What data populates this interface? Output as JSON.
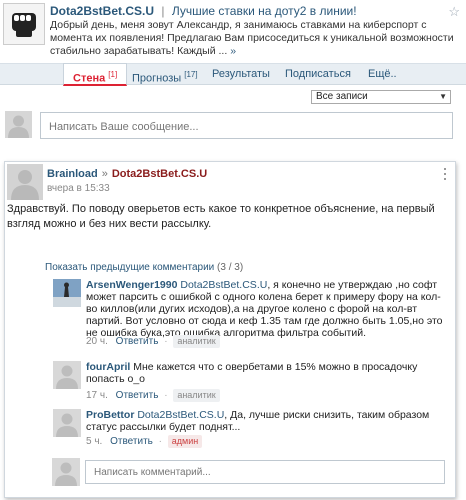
{
  "header": {
    "group_name": "Dota2BstBet.CS.U",
    "separator": "|",
    "tagline": "Лучшие ставки на доту2 в линии!",
    "description": "Добрый день, меня зовут Александр, я занимаюсь ставками на киберспорт с момента их появления! Предлагаю Вам присоседиться к уникальной возможности стабильно зарабатывать! Каждый ...",
    "more": "»",
    "star_icon": "star-icon"
  },
  "tabs": [
    {
      "label": "Стена",
      "count": "[1]"
    },
    {
      "label": "Прогнозы",
      "count": "[17]"
    },
    {
      "label": "Результаты",
      "count": ""
    },
    {
      "label": "Подписаться",
      "count": ""
    },
    {
      "label": "Ещё..",
      "count": ""
    }
  ],
  "filter": {
    "selected": "Все записи"
  },
  "compose": {
    "placeholder": "Написать Ваше сообщение..."
  },
  "post": {
    "author": "Brainload",
    "arrow": "»",
    "target": "Dota2BstBet.CS.U",
    "time": "вчера в 15:33",
    "text": "Здравствуй. По поводу оверьетов есть какое то конкретное объяснение, на первый взгляд можно и без них вести рассылку."
  },
  "comments_section": {
    "show_previous": "Показать предыдущие комментарии",
    "count": "(3 / 3)"
  },
  "comments": [
    {
      "author": "ArsenWenger1990",
      "mention": "Dota2BstBet.CS.U",
      "text": ", я конечно не утверждаю ,но софт может парсить с ошибкой с одного колена берет к примеру фору на кол-во киллов(или дугих исходов),а на другое колено с форой на кол-вт партий. Вот условно от сюда и кеф 1.35 там где должно быть 1.05,но это не ошибка бука,это ошибка алгоритма фильтра событий.",
      "time": "20 ч.",
      "reply": "Ответить",
      "dot": "·",
      "badge": "аналитик"
    },
    {
      "author": "fourApril",
      "mention": "",
      "text": " Мне кажется что с овербетами в 15% можно в просадочку попасть о_о",
      "time": "17 ч.",
      "reply": "Ответить",
      "dot": "·",
      "badge": "аналитик"
    },
    {
      "author": "ProBettor",
      "mention": "Dota2BstBet.CS.U",
      "text": ", Да, лучше риски снизить, таким образом статус рассылки будет поднят...",
      "time": "5 ч.",
      "reply": "Ответить",
      "dot": "·",
      "badge": "админ"
    }
  ],
  "reply_box": {
    "placeholder": "Написать комментарий..."
  },
  "colors": {
    "link": "#2b587a",
    "active_tab": "#dd2233",
    "target": "#8a1c1c"
  }
}
